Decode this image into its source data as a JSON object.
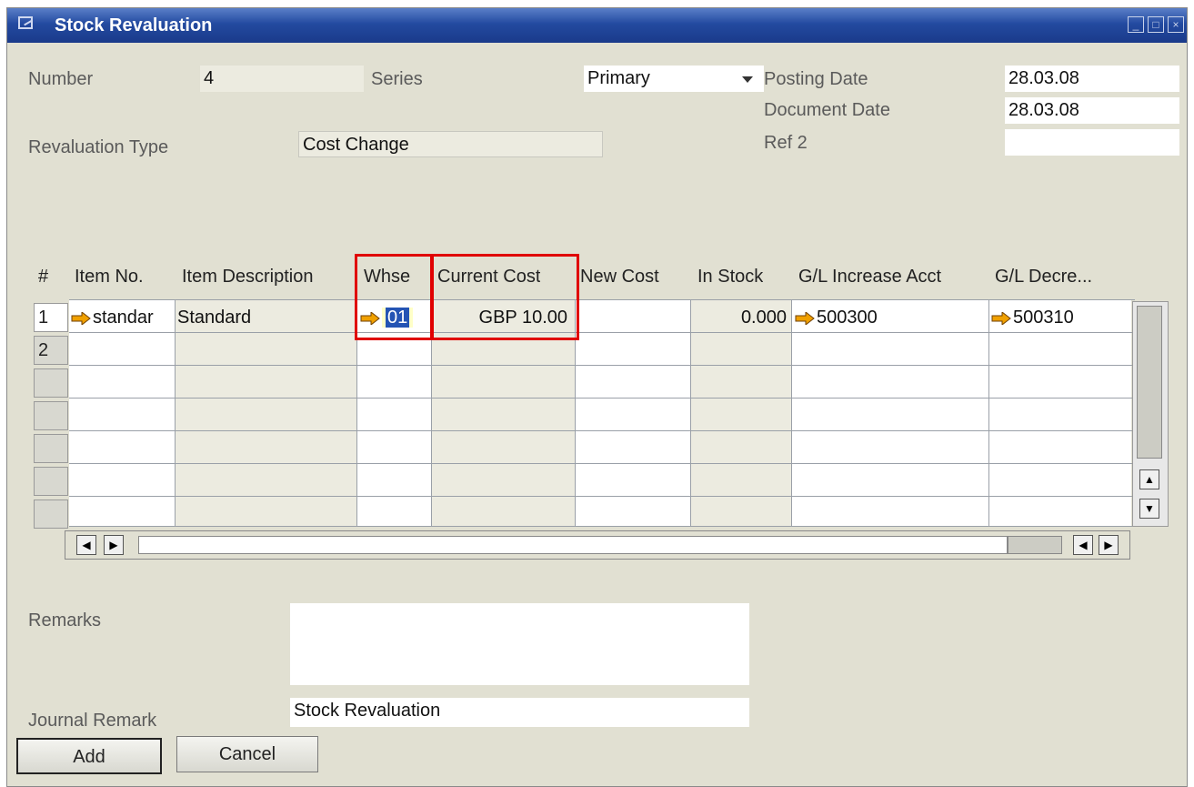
{
  "window": {
    "title": "Stock Revaluation"
  },
  "header": {
    "number_label": "Number",
    "number_value": "4",
    "series_label": "Series",
    "series_value": "Primary",
    "posting_date_label": "Posting Date",
    "posting_date_value": "28.03.08",
    "document_date_label": "Document Date",
    "document_date_value": "28.03.08",
    "ref2_label": "Ref 2",
    "ref2_value": "",
    "revaluation_type_label": "Revaluation Type",
    "revaluation_type_value": "Cost Change"
  },
  "grid": {
    "columns": [
      "#",
      "Item No.",
      "Item Description",
      "Whse",
      "Current Cost",
      "New Cost",
      "In Stock",
      "G/L Increase Acct",
      "G/L Decre..."
    ],
    "rows": [
      {
        "num": "1",
        "item_no": "standar",
        "item_description": "Standard",
        "whse": "01",
        "current_cost": "GBP 10.00",
        "new_cost": "",
        "in_stock": "0.000",
        "gl_increase": "500300",
        "gl_decrease": "500310"
      },
      {
        "num": "2"
      }
    ]
  },
  "footer": {
    "remarks_label": "Remarks",
    "remarks_value": "",
    "journal_remark_label": "Journal Remark",
    "journal_remark_value": "Stock Revaluation"
  },
  "buttons": {
    "add": "Add",
    "cancel": "Cancel"
  },
  "colors": {
    "link_arrow": "#f0a000",
    "highlight": "#e00000",
    "title_bar": "#234aa0"
  }
}
